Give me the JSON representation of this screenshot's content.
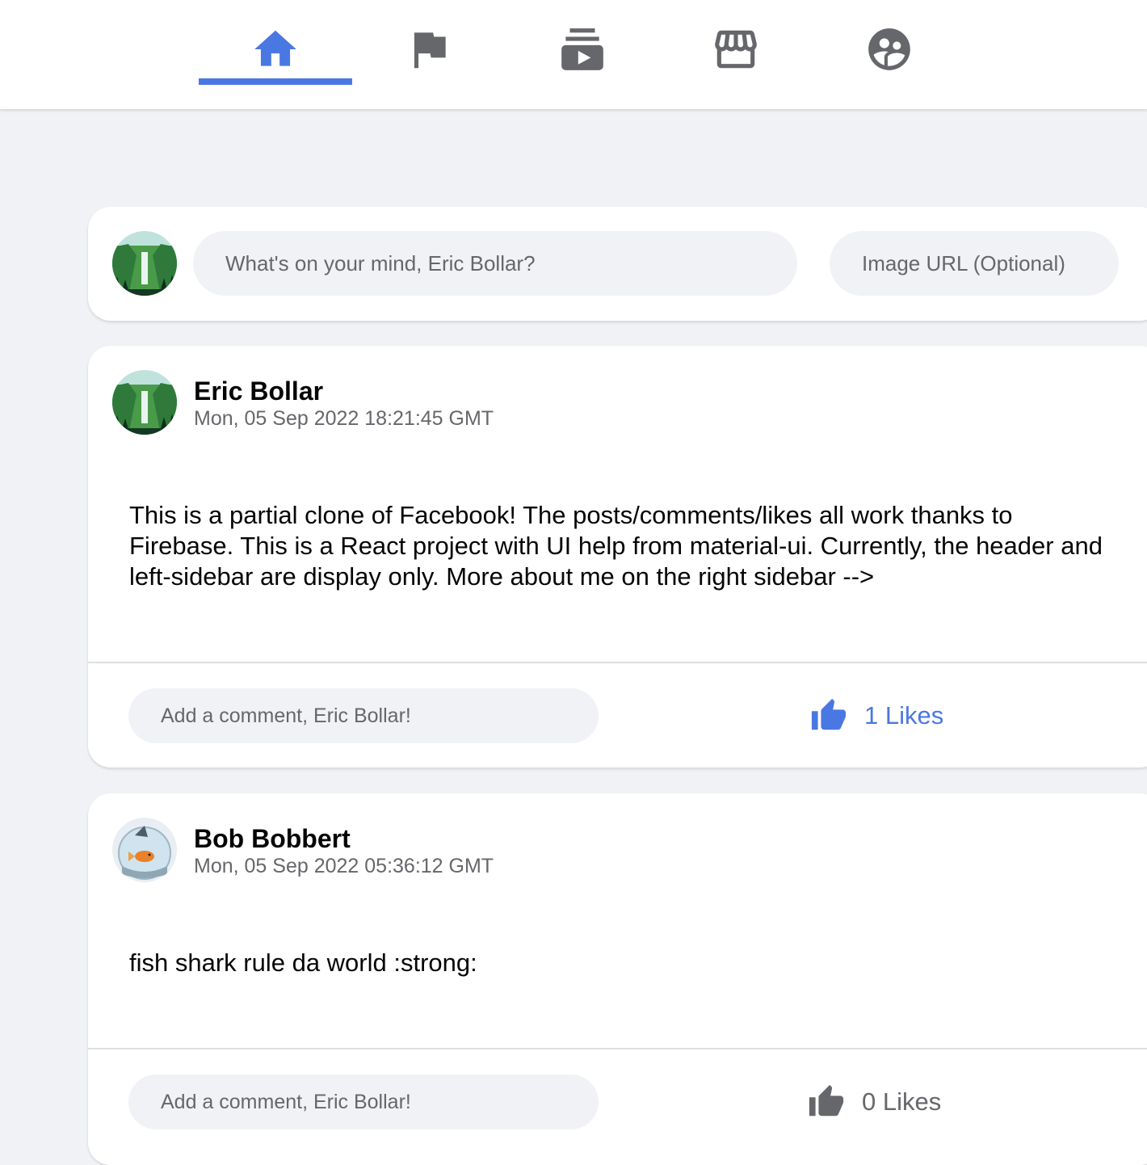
{
  "header": {
    "tabs": [
      {
        "name": "home",
        "icon": "home-icon",
        "active": true
      },
      {
        "name": "pages",
        "icon": "flag-icon",
        "active": false
      },
      {
        "name": "watch",
        "icon": "subscriptions-icon",
        "active": false
      },
      {
        "name": "marketplace",
        "icon": "storefront-icon",
        "active": false
      },
      {
        "name": "groups",
        "icon": "supervised-user-icon",
        "active": false
      }
    ],
    "colors": {
      "active": "#4a78e2",
      "inactive": "#65676b"
    }
  },
  "composer": {
    "post_placeholder": "What's on your mind, Eric Bollar?",
    "image_placeholder": "Image URL (Optional)"
  },
  "posts": [
    {
      "author": "Eric Bollar",
      "timestamp": "Mon, 05 Sep 2022 18:21:45 GMT",
      "text": "This is a partial clone of Facebook! The posts/comments/likes all work thanks to Firebase. This is a React project with UI help from material-ui. Currently, the header and left-sidebar are display only. More about me on the right sidebar -->",
      "comment_placeholder": "Add a comment, Eric Bollar!",
      "likes_label": "1 Likes",
      "liked": true,
      "like_color": "#4a78e2"
    },
    {
      "author": "Bob Bobbert",
      "timestamp": "Mon, 05 Sep 2022 05:36:12 GMT",
      "text": "fish shark rule da world :strong:",
      "comment_placeholder": "Add a comment, Eric Bollar!",
      "likes_label": "0 Likes",
      "liked": false,
      "like_color": "#65676b"
    }
  ]
}
